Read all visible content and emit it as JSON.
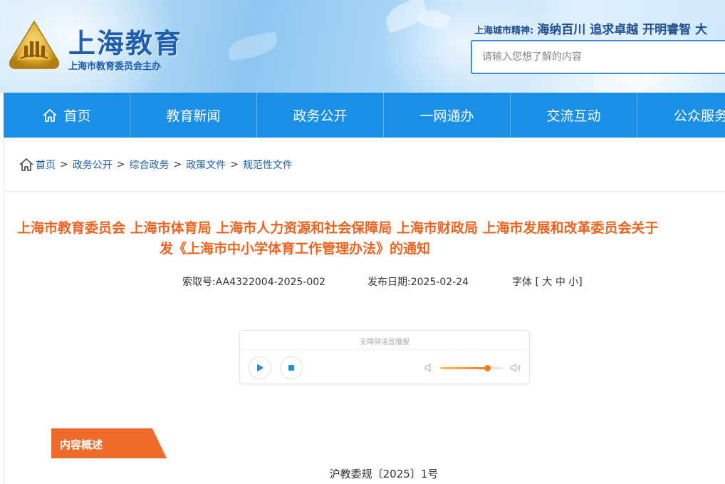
{
  "header": {
    "site_title": "上海教育",
    "site_subtitle": "上海市教育委员会主办",
    "spirit_label": "上海城市精神:",
    "spirit_text": "海纳百川 追求卓越 开明睿智 大",
    "search_placeholder": "请输入您想了解的内容"
  },
  "nav": {
    "items": [
      {
        "label": "首页",
        "icon": "home-icon"
      },
      {
        "label": "教育新闻"
      },
      {
        "label": "政务公开"
      },
      {
        "label": "一网通办"
      },
      {
        "label": "交流互动"
      },
      {
        "label": "公众服务"
      }
    ]
  },
  "breadcrumb": {
    "items": [
      "首页",
      "政务公开",
      "综合政务",
      "政策文件",
      "规范性文件"
    ],
    "separator": ">"
  },
  "document": {
    "title_line1": "上海市教育委员会 上海市体育局 上海市人力资源和社会保障局 上海市财政局 上海市发展和改革委员会关于",
    "title_line2": "发《上海市中小学体育工作管理办法》的通知",
    "index_label": "索取号:",
    "index_value": "AA4322004-2025-002",
    "date_label": "发布日期:",
    "date_value": "2025-02-24",
    "font_label": "字体 [",
    "font_large": "大",
    "font_medium": "中",
    "font_small": "小",
    "font_close": "]",
    "doc_number": "沪教委规〔2025〕1号"
  },
  "audio_player": {
    "title": "无障碍语音播报",
    "volume_level": 0.75,
    "accent": "#f47a1e"
  },
  "section": {
    "overview_label": "内容概述",
    "tag_color": "#f06a2b"
  },
  "colors": {
    "nav_bg": "#1a8fe6",
    "title_orange": "#f0631f",
    "link_blue": "#1d5da8"
  }
}
